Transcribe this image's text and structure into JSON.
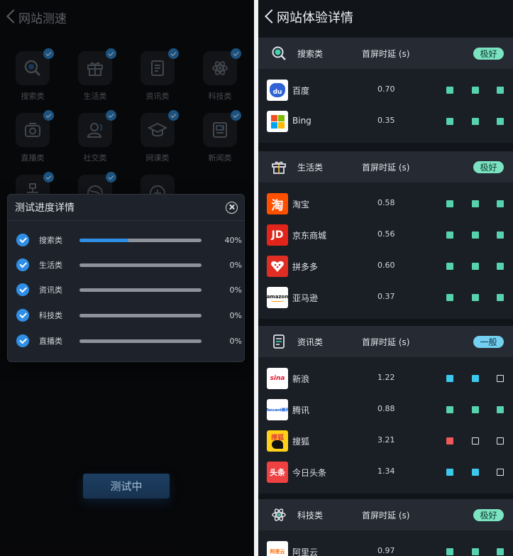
{
  "left": {
    "title": "网站测速",
    "categories": [
      "搜索类",
      "生活类",
      "资讯类",
      "科技类",
      "直播类",
      "社交类",
      "网课类",
      "新闻类"
    ],
    "modal": {
      "title": "测试进度详情",
      "rows": [
        {
          "label": "搜索类",
          "progress": 0.4,
          "percent": "40%"
        },
        {
          "label": "生活类",
          "progress": 0.0,
          "percent": "0%"
        },
        {
          "label": "资讯类",
          "progress": 0.0,
          "percent": "0%"
        },
        {
          "label": "科技类",
          "progress": 0.0,
          "percent": "0%"
        },
        {
          "label": "直播类",
          "progress": 0.0,
          "percent": "0%"
        }
      ]
    },
    "button_label": "测试中"
  },
  "right": {
    "title": "网站体验详情",
    "metric_label": "首屏时延 (s)",
    "sections": [
      {
        "name": "搜索类",
        "icon": "search-icon",
        "rating": "极好",
        "rating_kind": "good",
        "sites": [
          {
            "name": "百度",
            "logo": "baidu-logo",
            "value": "0.70",
            "dots": [
              "g",
              "g",
              "g"
            ]
          },
          {
            "name": "Bing",
            "logo": "bing-logo",
            "value": "0.35",
            "dots": [
              "g",
              "g",
              "g"
            ]
          }
        ]
      },
      {
        "name": "生活类",
        "icon": "gift-icon",
        "rating": "极好",
        "rating_kind": "good",
        "sites": [
          {
            "name": "淘宝",
            "logo": "taobao-logo",
            "value": "0.58",
            "dots": [
              "g",
              "g",
              "g"
            ]
          },
          {
            "name": "京东商城",
            "logo": "jd-logo",
            "value": "0.56",
            "dots": [
              "g",
              "g",
              "g"
            ]
          },
          {
            "name": "拼多多",
            "logo": "pinduoduo-logo",
            "value": "0.60",
            "dots": [
              "g",
              "g",
              "g"
            ]
          },
          {
            "name": "亚马逊",
            "logo": "amazon-logo",
            "value": "0.37",
            "dots": [
              "g",
              "g",
              "g"
            ]
          }
        ]
      },
      {
        "name": "资讯类",
        "icon": "document-icon",
        "rating": "一般",
        "rating_kind": "normal",
        "sites": [
          {
            "name": "新浪",
            "logo": "sina-logo",
            "value": "1.22",
            "dots": [
              "b",
              "b",
              "e"
            ]
          },
          {
            "name": "腾讯",
            "logo": "tencent-logo",
            "value": "0.88",
            "dots": [
              "g",
              "g",
              "g"
            ]
          },
          {
            "name": "搜狐",
            "logo": "sohu-logo",
            "value": "3.21",
            "dots": [
              "r",
              "e",
              "e"
            ]
          },
          {
            "name": "今日头条",
            "logo": "toutiao-logo",
            "value": "1.34",
            "dots": [
              "b",
              "b",
              "e"
            ]
          }
        ]
      },
      {
        "name": "科技类",
        "icon": "atom-icon",
        "rating": "极好",
        "rating_kind": "good",
        "sites": [
          {
            "name": "阿里云",
            "logo": "aliyun-logo",
            "value": "0.97",
            "dots": [
              "g",
              "g",
              "g"
            ]
          }
        ]
      }
    ]
  },
  "logo_text": {
    "baidu": "du",
    "bing": "",
    "taobao": "淘",
    "jd": "JD",
    "amazon": "amazon",
    "sina": "sina",
    "tencent": "Tencent腾讯",
    "sohu": "搜狐",
    "toutiao": "头条",
    "aliyun": "阿里云"
  },
  "colors": {
    "good": "#56d2ad",
    "normal": "#3cc8ec",
    "bad": "#ee5959",
    "accent": "#2f8fe6"
  }
}
